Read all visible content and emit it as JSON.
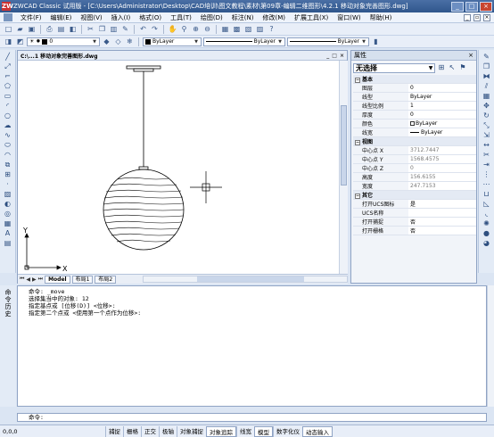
{
  "window": {
    "title": "ZWCAD Classic 试用版 - [C:\\Users\\Administrator\\Desktop\\CAD培训\\图文教程\\素材\\第09章-编辑二维图形\\4.2.1 移动对象完善图形.dwg]",
    "app_icon": "ZW"
  },
  "menu": [
    "文件(F)",
    "编辑(E)",
    "视图(V)",
    "插入(I)",
    "格式(O)",
    "工具(T)",
    "绘图(D)",
    "标注(N)",
    "修改(M)",
    "扩展工具(X)",
    "窗口(W)",
    "帮助(H)"
  ],
  "layer_toolbar": {
    "layer_value": "0",
    "color_value": "ByLayer",
    "linetype_value": "ByLayer",
    "lineweight_value": "ByLayer"
  },
  "document": {
    "title": "C:\\...1 移动对象完善图形.dwg",
    "tabs": [
      "Model",
      "布局1",
      "布局2"
    ],
    "ucs_x": "X",
    "ucs_y": "Y"
  },
  "properties": {
    "header": "属性",
    "selection": "无选择",
    "sections": [
      {
        "name": "基本",
        "rows": [
          {
            "key": "图层",
            "value": "0"
          },
          {
            "key": "线型",
            "value": "ByLayer"
          },
          {
            "key": "线型比例",
            "value": "1"
          },
          {
            "key": "厚度",
            "value": "0"
          },
          {
            "key": "颜色",
            "value": "ByLayer"
          },
          {
            "key": "线宽",
            "value": "ByLayer"
          }
        ]
      },
      {
        "name": "视图",
        "rows": [
          {
            "key": "中心点 X",
            "value": "3712.7447"
          },
          {
            "key": "中心点 Y",
            "value": "1568.4575"
          },
          {
            "key": "中心点 Z",
            "value": "0"
          },
          {
            "key": "高度",
            "value": "156.6155"
          },
          {
            "key": "宽度",
            "value": "247.7153"
          }
        ]
      },
      {
        "name": "其它",
        "rows": [
          {
            "key": "打开UCS图标",
            "value": "是"
          },
          {
            "key": "UCS名称",
            "value": ""
          },
          {
            "key": "打开捕捉",
            "value": "否"
          },
          {
            "key": "打开栅格",
            "value": "否"
          }
        ]
      }
    ]
  },
  "command": {
    "side_label": [
      "命",
      "令",
      "历",
      "史"
    ],
    "history": [
      "命令: _move",
      "选择集当中的对象: 12",
      "指定基点或 [位移(D)] <位移>:",
      "指定第二个点或 <使用第一个点作为位移>:"
    ],
    "prompt": "命令:"
  },
  "status": {
    "coords": "0,0,0",
    "buttons": [
      "捕捉",
      "栅格",
      "正交",
      "极轴",
      "对象捕捉",
      "对象追踪",
      "线宽",
      "模型",
      "数字化仪",
      "动态输入"
    ],
    "active_buttons": [
      "对象追踪",
      "模型",
      "动态输入"
    ]
  }
}
